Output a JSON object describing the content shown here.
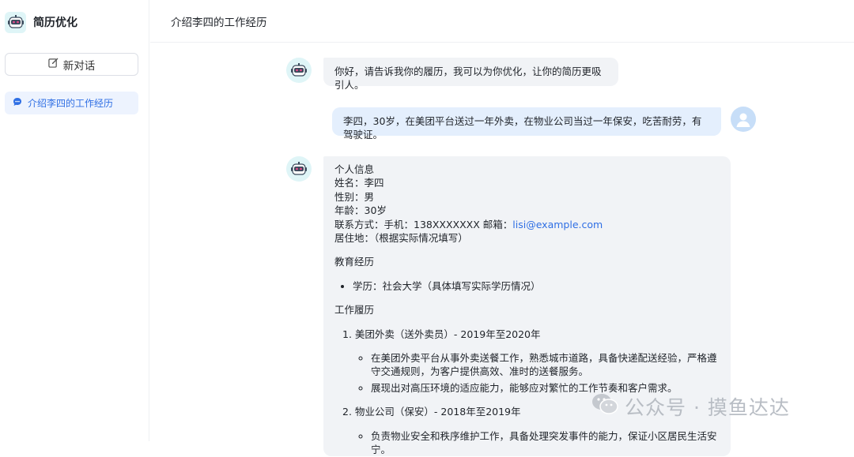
{
  "sidebar": {
    "brand_title": "简历优化",
    "new_chat_label": "新对话",
    "conversations": [
      {
        "label": "介绍李四的工作经历"
      }
    ]
  },
  "header": {
    "title": "介绍李四的工作经历"
  },
  "messages": {
    "greeting": "你好，请告诉我你的履历，我可以为你优化，让你的简历更吸引人。",
    "user": "李四，30岁，在美团平台送过一年外卖，在物业公司当过一年保安，吃苦耐劳，有驾驶证。",
    "response": {
      "personal_heading": "个人信息",
      "name": "姓名：李四",
      "gender": "性别：男",
      "age": "年龄：30岁",
      "contact_prefix": "联系方式：手机：138XXXXXXX 邮箱：",
      "email": "lisi@example.com",
      "residence": "居住地：（根据实际情况填写）",
      "education_heading": "教育经历",
      "education_item": "学历：社会大学（具体填写实际学历情况）",
      "work_heading": "工作履历",
      "jobs": [
        {
          "title": "1. 美团外卖（送外卖员）- 2019年至2020年",
          "bullets": [
            "在美团外卖平台从事外卖送餐工作，熟悉城市道路，具备快递配送经验，严格遵守交通规则，为客户提供高效、准时的送餐服务。",
            "展现出对高压环境的适应能力，能够应对繁忙的工作节奏和客户需求。"
          ]
        },
        {
          "title": "2. 物业公司（保安）- 2018年至2019年",
          "bullets": [
            "负责物业安全和秩序维护工作，具备处理突发事件的能力，保证小区居民生活安宁。"
          ]
        }
      ]
    }
  },
  "watermark": {
    "text": "公众号 · 摸鱼达达"
  },
  "colors": {
    "accent": "#2f6fe4",
    "bot_avatar_bg": "#dff5f7",
    "user_bubble": "#e4effd",
    "bot_bubble": "#f1f3f6"
  }
}
